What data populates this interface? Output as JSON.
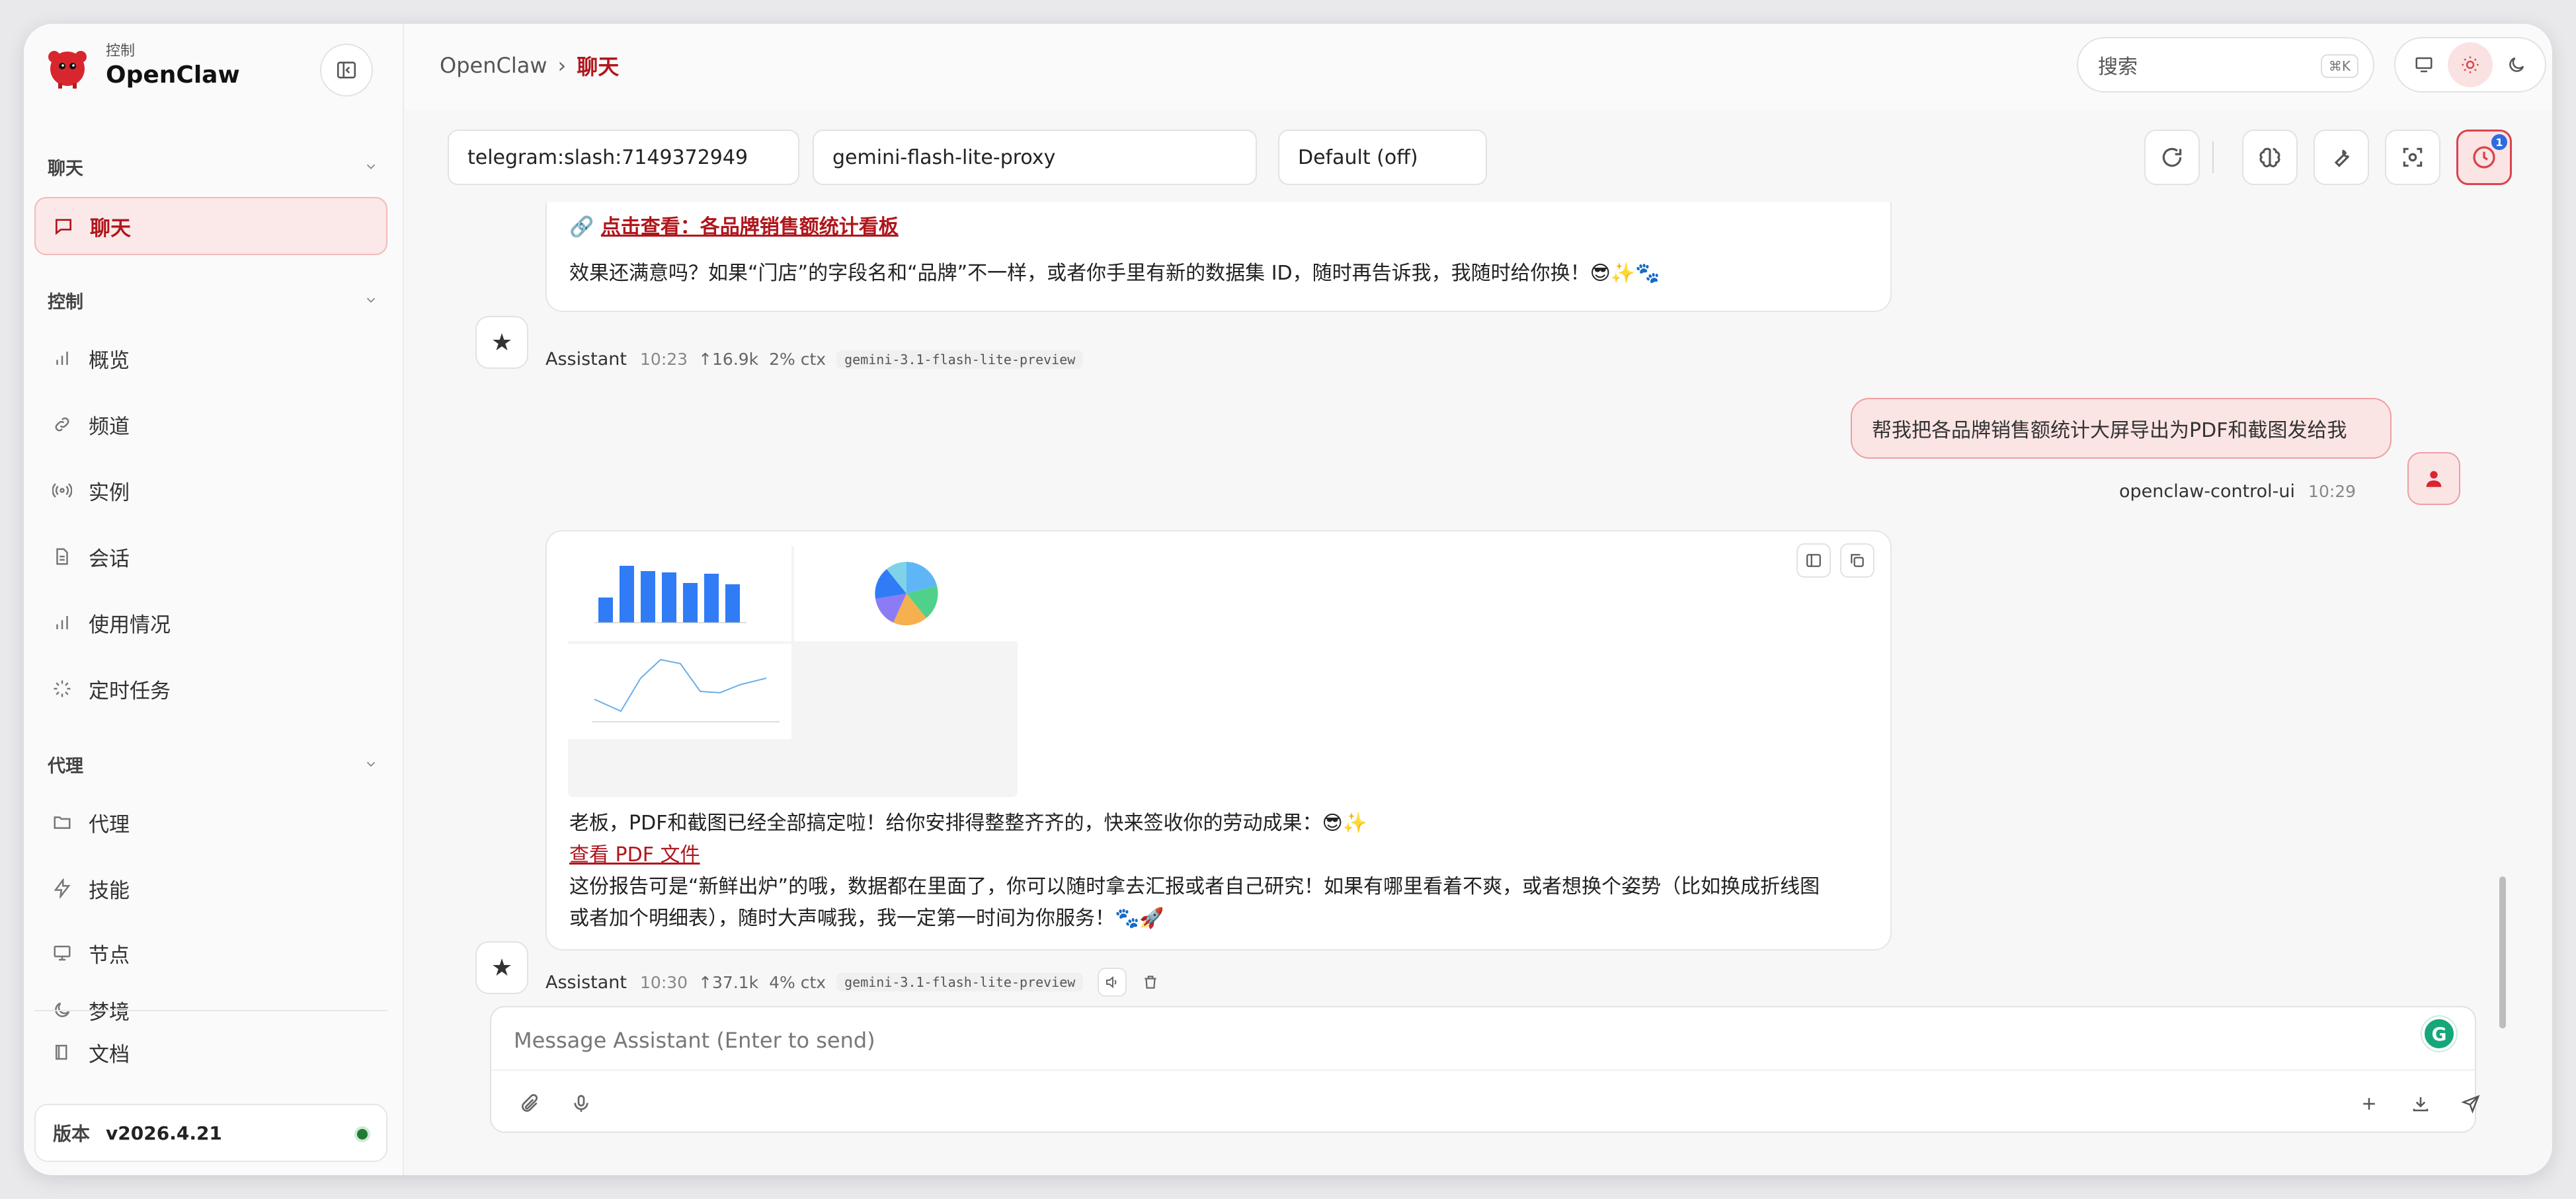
{
  "brand": {
    "sub": "控制",
    "name": "OpenClaw"
  },
  "sidebar": {
    "sections": [
      {
        "label": "聊天",
        "items": [
          {
            "label": "聊天",
            "icon": "chat-bubble-icon",
            "active": true
          }
        ]
      },
      {
        "label": "控制",
        "items": [
          {
            "label": "概览",
            "icon": "bar-chart-icon"
          },
          {
            "label": "频道",
            "icon": "link-icon"
          },
          {
            "label": "实例",
            "icon": "radio-icon"
          },
          {
            "label": "会话",
            "icon": "document-icon"
          },
          {
            "label": "使用情况",
            "icon": "bar-chart-icon"
          },
          {
            "label": "定时任务",
            "icon": "spinner-icon"
          }
        ]
      },
      {
        "label": "代理",
        "items": [
          {
            "label": "代理",
            "icon": "folder-icon"
          },
          {
            "label": "技能",
            "icon": "lightning-icon"
          },
          {
            "label": "节点",
            "icon": "monitor-icon"
          },
          {
            "label": "梦境",
            "icon": "moon-icon"
          }
        ]
      }
    ],
    "docs_label": "文档",
    "version_label": "版本",
    "version_value": "v2026.4.21"
  },
  "topbar": {
    "breadcrumb": [
      "OpenClaw",
      "聊天"
    ],
    "search_placeholder": "搜索",
    "search_shortcut": "⌘K"
  },
  "controls": {
    "session": "telegram:slash:7149372949",
    "model": "gemini-flash-lite-proxy",
    "thinking": "Default (off)",
    "badge_count": "1"
  },
  "messages": {
    "m1": {
      "link_text": "点击查看：各品牌销售额统计看板",
      "body": "效果还满意吗？如果“门店”的字段名和“品牌”不一样，或者你手里有新的数据集 ID，随时再告诉我，我随时给你换！😎✨🐾",
      "sender": "Assistant",
      "time": "10:23",
      "tokens": "↑16.9k",
      "ctx": "2% ctx",
      "model": "gemini-3.1-flash-lite-preview"
    },
    "user": {
      "text": "帮我把各品牌销售额统计大屏导出为PDF和截图发给我",
      "sender": "openclaw-control-ui",
      "time": "10:29"
    },
    "m2": {
      "line1": "老板，PDF和截图已经全部搞定啦！给你安排得整整齐齐的，快来签收你的劳动成果：😎✨",
      "link_text": "查看 PDF 文件",
      "line3": "这份报告可是“新鲜出炉”的哦，数据都在里面了，你可以随时拿去汇报或者自己研究！如果有哪里看着不爽，或者想换个姿势（比如换成折线图",
      "line4": "或者加个明细表），随时大声喊我，我一定第一时间为你服务！🐾🚀",
      "sender": "Assistant",
      "time": "10:30",
      "tokens": "↑37.1k",
      "ctx": "4% ctx",
      "model": "gemini-3.1-flash-lite-preview"
    }
  },
  "composer": {
    "placeholder": "Message Assistant (Enter to send)"
  },
  "colors": {
    "accent": "#b0161c",
    "accent_bg": "#fbe8e8",
    "bar": "#2f7cf6"
  }
}
